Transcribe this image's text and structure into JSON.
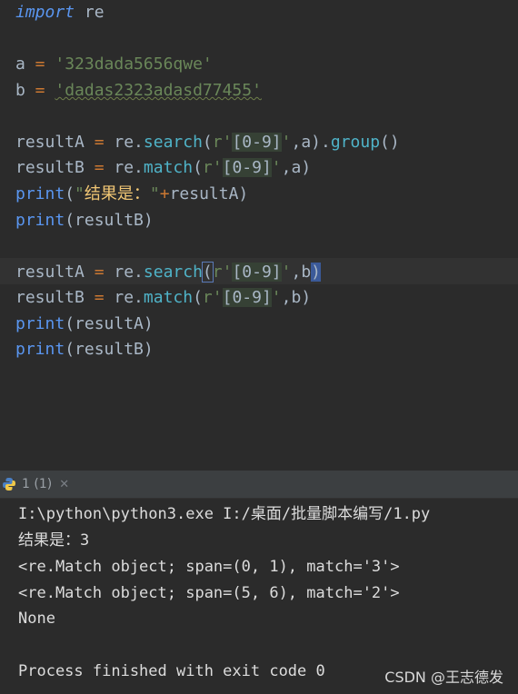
{
  "editor": {
    "lines": [
      [
        [
          "kwi",
          "import"
        ],
        [
          "var",
          " re"
        ]
      ],
      [],
      [
        [
          "var",
          "a"
        ],
        [
          "op",
          " = "
        ],
        [
          "str",
          "'323dada5656qwe'"
        ]
      ],
      [
        [
          "var",
          "b"
        ],
        [
          "op",
          " = "
        ],
        [
          "strsq",
          "'dadas2323adasd77455'"
        ]
      ],
      [],
      [
        [
          "var",
          "resultA"
        ],
        [
          "op",
          " = "
        ],
        [
          "var",
          "re."
        ],
        [
          "fn",
          "search"
        ],
        [
          "pn",
          "("
        ],
        [
          "str",
          "r'"
        ],
        [
          "rx",
          "[0-9]"
        ],
        [
          "str",
          "'"
        ],
        [
          "pn",
          ",a)."
        ],
        [
          "fn",
          "group"
        ],
        [
          "pn",
          "()"
        ]
      ],
      [
        [
          "var",
          "resultB"
        ],
        [
          "op",
          " = "
        ],
        [
          "var",
          "re."
        ],
        [
          "fn",
          "match"
        ],
        [
          "pn",
          "("
        ],
        [
          "str",
          "r'"
        ],
        [
          "rx",
          "[0-9]"
        ],
        [
          "str",
          "'"
        ],
        [
          "pn",
          ",a)"
        ]
      ],
      [
        [
          "kw",
          "print"
        ],
        [
          "pn",
          "("
        ],
        [
          "str",
          "\""
        ],
        [
          "cn",
          "结果是："
        ],
        [
          "str",
          "\""
        ],
        [
          "op",
          "+"
        ],
        [
          "var",
          "resultA"
        ],
        [
          "pn",
          ")"
        ]
      ],
      [
        [
          "kw",
          "print"
        ],
        [
          "pn",
          "(resultB)"
        ]
      ],
      [],
      [
        [
          "var",
          "resultA"
        ],
        [
          "op",
          " = "
        ],
        [
          "var",
          "re."
        ],
        [
          "fn",
          "search"
        ],
        [
          "brk",
          "("
        ],
        [
          "str",
          "r'"
        ],
        [
          "rx",
          "[0-9]"
        ],
        [
          "str",
          "'"
        ],
        [
          "pn",
          ",b"
        ],
        [
          "brkh",
          ")"
        ]
      ],
      [
        [
          "var",
          "resultB"
        ],
        [
          "op",
          " = "
        ],
        [
          "var",
          "re."
        ],
        [
          "fn",
          "match"
        ],
        [
          "pn",
          "("
        ],
        [
          "str",
          "r'"
        ],
        [
          "rx",
          "[0-9]"
        ],
        [
          "str",
          "'"
        ],
        [
          "pn",
          ",b)"
        ]
      ],
      [
        [
          "kw",
          "print"
        ],
        [
          "pn",
          "(resultA)"
        ]
      ],
      [
        [
          "kw",
          "print"
        ],
        [
          "pn",
          "(resultB)"
        ]
      ]
    ]
  },
  "run_panel": {
    "tab_label": "1 (1)",
    "close_glyph": "✕",
    "icon": "python-icon"
  },
  "console": {
    "lines": [
      "I:\\python\\python3.exe I:/桌面/批量脚本编写/1.py",
      "结果是：3",
      "<re.Match object; span=(0, 1), match='3'>",
      "<re.Match object; span=(5, 6), match='2'>",
      "None",
      "",
      "Process finished with exit code 0"
    ]
  },
  "watermark": "CSDN @王志德发",
  "colors": {
    "background": "#2b2b2b",
    "keyword": "#5a96f0",
    "string": "#6a8759",
    "function": "#4fb3c8",
    "operator": "#cc7832"
  }
}
